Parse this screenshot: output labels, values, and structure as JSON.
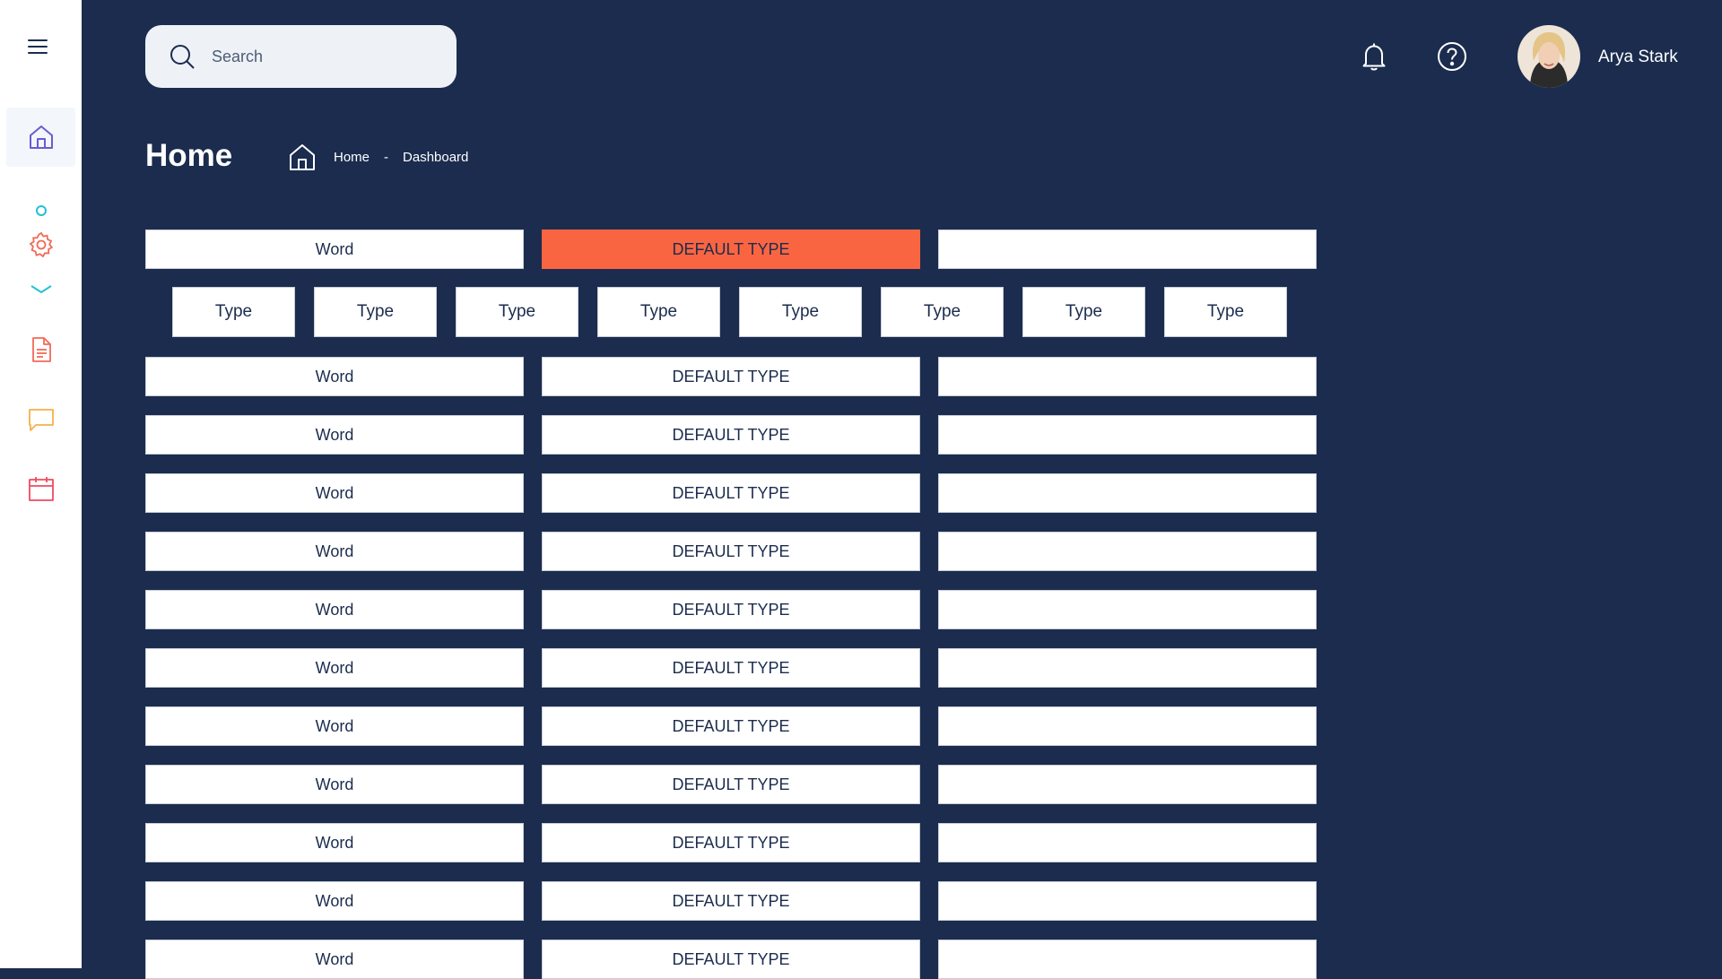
{
  "search": {
    "placeholder": "Search"
  },
  "user": {
    "name": "Arya Stark"
  },
  "page": {
    "title": "Home"
  },
  "breadcrumb": {
    "home": "Home",
    "separator": "-",
    "current": "Dashboard"
  },
  "colors": {
    "navy": "#1b2c4e",
    "accent": "#fa6541",
    "teal": "#23c0d6",
    "purple": "#6b5bd2",
    "coral": "#f26a57",
    "amber": "#f5b14c",
    "red": "#ee4b5f"
  },
  "sidebar": {
    "items": [
      {
        "icon": "home-icon",
        "active": true
      },
      {
        "icon": "gear-icon",
        "active": false
      },
      {
        "icon": "document-icon",
        "active": false
      },
      {
        "icon": "chat-icon",
        "active": false
      },
      {
        "icon": "calendar-icon",
        "active": false
      }
    ]
  },
  "header_row": {
    "word": "Word",
    "type": "DEFAULT TYPE",
    "value": ""
  },
  "type_buttons": [
    "Type",
    "Type",
    "Type",
    "Type",
    "Type",
    "Type",
    "Type",
    "Type"
  ],
  "rows": [
    {
      "word": "Word",
      "type": "DEFAULT TYPE",
      "value": ""
    },
    {
      "word": "Word",
      "type": "DEFAULT TYPE",
      "value": ""
    },
    {
      "word": "Word",
      "type": "DEFAULT TYPE",
      "value": ""
    },
    {
      "word": "Word",
      "type": "DEFAULT TYPE",
      "value": ""
    },
    {
      "word": "Word",
      "type": "DEFAULT TYPE",
      "value": ""
    },
    {
      "word": "Word",
      "type": "DEFAULT TYPE",
      "value": ""
    },
    {
      "word": "Word",
      "type": "DEFAULT TYPE",
      "value": ""
    },
    {
      "word": "Word",
      "type": "DEFAULT TYPE",
      "value": ""
    },
    {
      "word": "Word",
      "type": "DEFAULT TYPE",
      "value": ""
    },
    {
      "word": "Word",
      "type": "DEFAULT TYPE",
      "value": ""
    },
    {
      "word": "Word",
      "type": "DEFAULT TYPE",
      "value": ""
    }
  ]
}
